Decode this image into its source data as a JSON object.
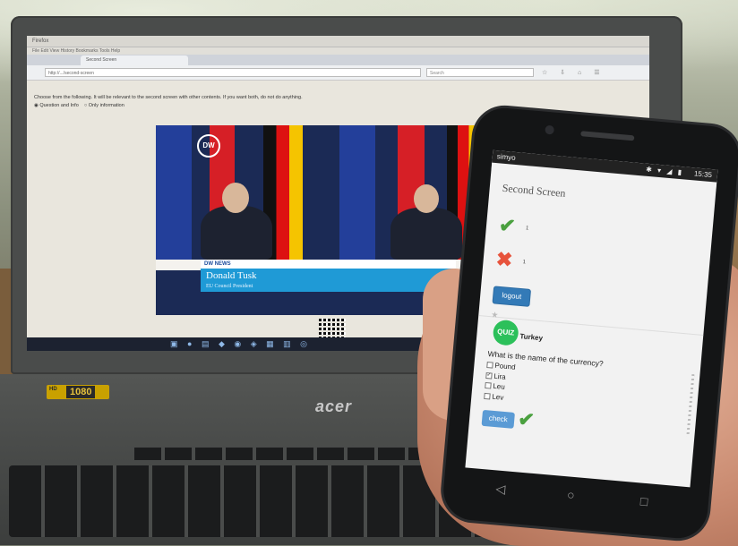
{
  "laptop": {
    "browser": {
      "window_title": "Firefox",
      "menu": "File  Edit  View  History  Bookmarks  Tools  Help",
      "tab_title": "Second Screen",
      "url": "http://.../second-screen",
      "search_placeholder": "Search"
    },
    "page": {
      "prompt": "Choose from the following. It will be relevant to the second screen with other contents. If you want both, do not do anything.",
      "radio_options": [
        "Question and Info",
        "Only information"
      ]
    },
    "video": {
      "channel_logo": "DW",
      "lower_third_tag": "DW NEWS",
      "name": "Donald Tusk",
      "role": "EU Council President"
    },
    "badge_label": "1080",
    "brand": "acer"
  },
  "phone": {
    "status_carrier": "simyo",
    "status_time": "15:35",
    "app": {
      "title": "Second Screen",
      "correct_count": "1",
      "wrong_count": "1",
      "logout_label": "logout",
      "quiz_logo_text": "QUIZ",
      "quiz_topic": "Turkey",
      "question": "What is the name of the currency?",
      "options": [
        {
          "label": "Pound",
          "checked": false
        },
        {
          "label": "Lira",
          "checked": true
        },
        {
          "label": "Leu",
          "checked": false
        },
        {
          "label": "Lev",
          "checked": false
        }
      ],
      "check_label": "check"
    }
  },
  "colors": {
    "primary_button": "#337ab7",
    "correct": "#4aa03f",
    "wrong": "#e7533c",
    "quiz_logo": "#2cc05a",
    "lower_third": "#1f9ad6"
  }
}
